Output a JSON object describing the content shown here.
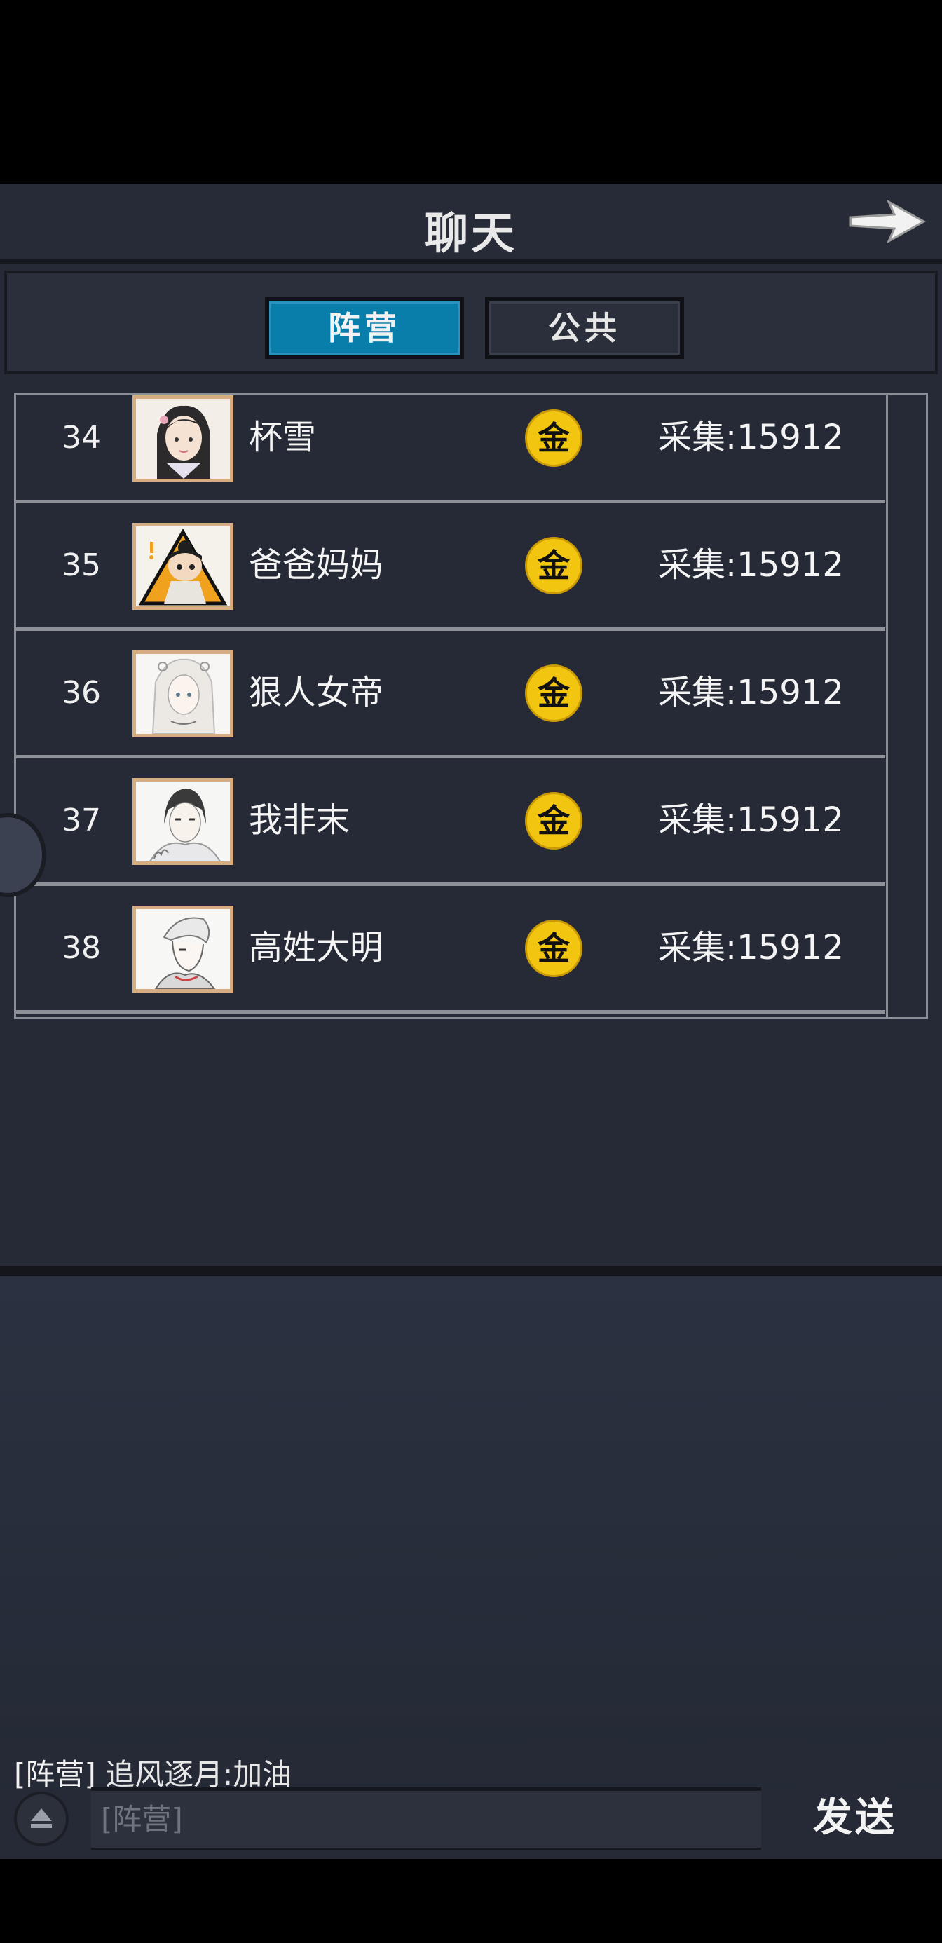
{
  "header": {
    "title": "聊天"
  },
  "tabs": [
    {
      "label": "阵营",
      "active": true
    },
    {
      "label": "公共",
      "active": false
    }
  ],
  "ranking": [
    {
      "rank": "34",
      "name": "杯雪",
      "badge": "金",
      "score": "采集:15912"
    },
    {
      "rank": "35",
      "name": "爸爸妈妈",
      "badge": "金",
      "score": "采集:15912"
    },
    {
      "rank": "36",
      "name": "狠人女帝",
      "badge": "金",
      "score": "采集:15912"
    },
    {
      "rank": "37",
      "name": "我非末",
      "badge": "金",
      "score": "采集:15912"
    },
    {
      "rank": "38",
      "name": "高姓大明",
      "badge": "金",
      "score": "采集:15912"
    }
  ],
  "chat": {
    "last_message": {
      "channel": "[阵营]",
      "text": "追风逐月:加油"
    },
    "input_placeholder": "[阵营]",
    "send_label": "发送"
  },
  "colors": {
    "active_tab": "#0a7eaa",
    "coin": "#f2c511",
    "panel": "#262a36",
    "avatar_border": "#d6ac80"
  }
}
